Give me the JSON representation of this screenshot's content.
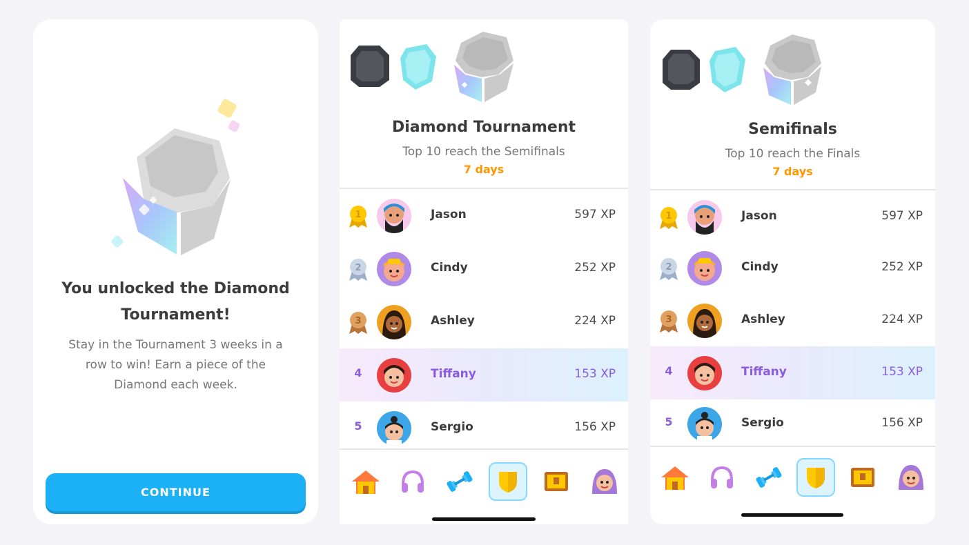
{
  "unlock_card": {
    "title": "You unlocked the Diamond Tournament!",
    "description": "Stay in the Tournament 3 weeks in a row to win! Earn a piece of the Diamond each week.",
    "continue_label": "CONTINUE"
  },
  "diamond_card": {
    "title": "Diamond Tournament",
    "subtitle": "Top 10 reach the Semifinals",
    "days": "7 days",
    "rows": [
      {
        "rank": "1",
        "name": "Jason",
        "xp": "597 XP"
      },
      {
        "rank": "2",
        "name": "Cindy",
        "xp": "252 XP"
      },
      {
        "rank": "3",
        "name": "Ashley",
        "xp": "224 XP"
      },
      {
        "rank": "4",
        "name": "Tiffany",
        "xp": "153 XP"
      },
      {
        "rank": "5",
        "name": "Sergio",
        "xp": "156 XP"
      }
    ]
  },
  "semifinals_card": {
    "title": "Semifinals",
    "subtitle": "Top 10 reach the Finals",
    "days": "7 days",
    "rows": [
      {
        "rank": "1",
        "name": "Jason",
        "xp": "597 XP"
      },
      {
        "rank": "2",
        "name": "Cindy",
        "xp": "252 XP"
      },
      {
        "rank": "3",
        "name": "Ashley",
        "xp": "224 XP"
      },
      {
        "rank": "4",
        "name": "Tiffany",
        "xp": "153 XP"
      },
      {
        "rank": "5",
        "name": "Sergio",
        "xp": "156 XP"
      }
    ]
  },
  "tabs": [
    "home-icon",
    "headphones-icon",
    "dumbbell-icon",
    "shield-icon",
    "chest-icon",
    "profile-icon"
  ],
  "colors": {
    "primary_button": "#1cb0f6",
    "highlight_text": "#8a5ce0",
    "days_orange": "#ff9600",
    "gold": "#ffc800",
    "silver": "#b5c5d9",
    "bronze": "#cd8a4d"
  }
}
